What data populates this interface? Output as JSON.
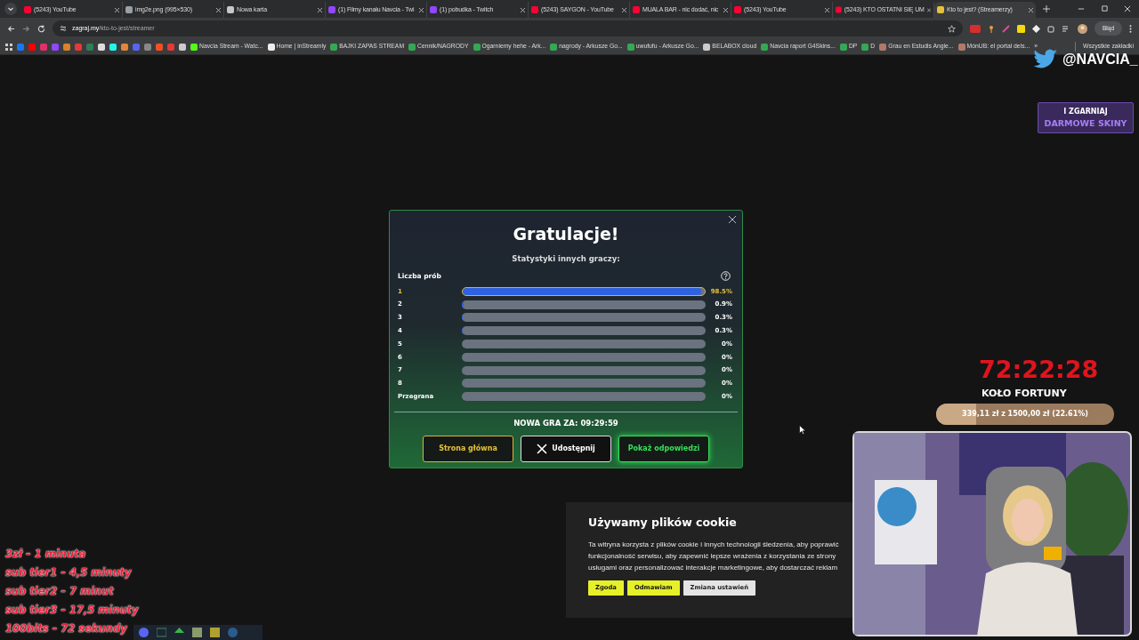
{
  "tabs": [
    {
      "title": "(5243) YouTube",
      "color": "#ff0033",
      "selected": false
    },
    {
      "title": "img2e.png (995×530)",
      "color": "#9aa0a6",
      "selected": false
    },
    {
      "title": "Nowa karta",
      "color": "#c8c8c8",
      "selected": false
    },
    {
      "title": "(1) Filmy kanału Navcia - Twi",
      "color": "#9146ff",
      "selected": false
    },
    {
      "title": "(1) pobudka - Twitch",
      "color": "#9146ff",
      "selected": false
    },
    {
      "title": "(5243) SAYGON - YouTube",
      "color": "#ff0033",
      "selected": false
    },
    {
      "title": "MUALA BAR - nic dodać, nic",
      "color": "#ff0033",
      "selected": false
    },
    {
      "title": "(5243) YouTube",
      "color": "#ff0033",
      "selected": false
    },
    {
      "title": "(5243) KTO OSTATNI SIĘ UM",
      "color": "#ff0033",
      "selected": false
    },
    {
      "title": "Kto to jest? (Streamerzy)",
      "color": "#e8c13a",
      "selected": true
    }
  ],
  "address": {
    "host": "zagraj.my",
    "path": "/kto-to-jest/streamer"
  },
  "profile_button": "Błąd",
  "bookmarks": [
    {
      "color": "#1877f2"
    },
    {
      "color": "#ff0000"
    },
    {
      "color": "#e1306c"
    },
    {
      "color": "#9146ff"
    },
    {
      "color": "#d9822b"
    },
    {
      "color": "#e53935"
    },
    {
      "color": "#2e7d5b"
    },
    {
      "color": "#dddddd"
    },
    {
      "color": "#25f4ee"
    },
    {
      "color": "#e0873a"
    },
    {
      "color": "#5865f2"
    },
    {
      "color": "#888888"
    },
    {
      "color": "#f25022"
    },
    {
      "color": "#e53935"
    },
    {
      "color": "#cccccc"
    },
    {
      "label": "Navcia Stream - Watc...",
      "color": "#53fc18"
    },
    {
      "label": "Home | inStreamly",
      "color": "#eeeeee"
    },
    {
      "label": "BAJKI ZAPAS STREAM",
      "color": "#34a853"
    },
    {
      "label": "Cennik/NAGRODY",
      "color": "#34a853"
    },
    {
      "label": "Ogarniemy hehe - Ark...",
      "color": "#34a853"
    },
    {
      "label": "nagrody - Arkusze Go...",
      "color": "#34a853"
    },
    {
      "label": "uwufufu - Arkusze Go...",
      "color": "#34a853"
    },
    {
      "label": "BELABOX cloud",
      "color": "#cccccc"
    },
    {
      "label": "Navcia raport G4Skins...",
      "color": "#34a853"
    },
    {
      "label": "DP",
      "color": "#34a853"
    },
    {
      "label": "D",
      "color": "#34a853"
    },
    {
      "label": "Grau en Estudis Angle...",
      "color": "#b07a6a"
    },
    {
      "label": "MónUB: el portal dels...",
      "color": "#b07a6a"
    }
  ],
  "bookmarks_more": "»",
  "all_bookmarks": "Wszystkie zakładki",
  "modal": {
    "title": "Gratulacje!",
    "subtitle": "Statystyki innych graczy:",
    "header": "Liczba prób",
    "rows": [
      {
        "label": "1",
        "level": 0.985,
        "value": "98.5%",
        "selected": true
      },
      {
        "label": "2",
        "level": 0.009,
        "value": "0.9%",
        "selected": false
      },
      {
        "label": "3",
        "level": 0.003,
        "value": "0.3%",
        "selected": false
      },
      {
        "label": "4",
        "level": 0.003,
        "value": "0.3%",
        "selected": false
      },
      {
        "label": "5",
        "value": "0%",
        "selected": false
      },
      {
        "label": "6",
        "value": "0%",
        "selected": false
      },
      {
        "label": "7",
        "value": "0%",
        "selected": false
      },
      {
        "label": "8",
        "value": "0%",
        "selected": false
      },
      {
        "label": "Przegrana",
        "value": "0%",
        "selected": false
      }
    ],
    "countdown": "NOWA GRA ZA: 09:29:59",
    "buttons": [
      {
        "label": "Strona główna",
        "kind": "home"
      },
      {
        "label": "Udostępnij",
        "kind": "share"
      },
      {
        "label": "Pokaż odpowiedzi",
        "kind": "answers"
      }
    ]
  },
  "cookie": {
    "title": "Używamy plików cookie",
    "lines": [
      "Ta witryna korzysta z plików cookie i innych technologii śledzenia, aby poprawić",
      "funkcjonalność serwisu, aby zapewnić lepsze wrażenia z korzystania ze strony",
      "usługami oraz personalizować interakcje marketingowe, aby dostarczać reklam"
    ],
    "buttons": [
      {
        "label": "Zgoda",
        "kind": "accept"
      },
      {
        "label": "Odmawiam",
        "kind": "accept"
      },
      {
        "label": "Zmiana ustawień",
        "kind": "settings"
      }
    ]
  },
  "overlay": {
    "handle": "@NAVCIA_",
    "promo_top": "I ZGARNIAJ",
    "promo_bottom": "DARMOWE SKINY",
    "timer": "72:22:28",
    "wheel_title": "KOŁO FORTUNY",
    "wheel_progress": {
      "text": "339,11 zł z 1500,00 zł (22.61%)",
      "level": 0.2261
    },
    "rates": [
      "3zł – 1 minuta",
      "sub tier1 – 4,5 minuty",
      "sub tier2 – 7 minut",
      "sub tier3 – 17,5 minuty",
      "100bits – 72 sekundy"
    ]
  }
}
